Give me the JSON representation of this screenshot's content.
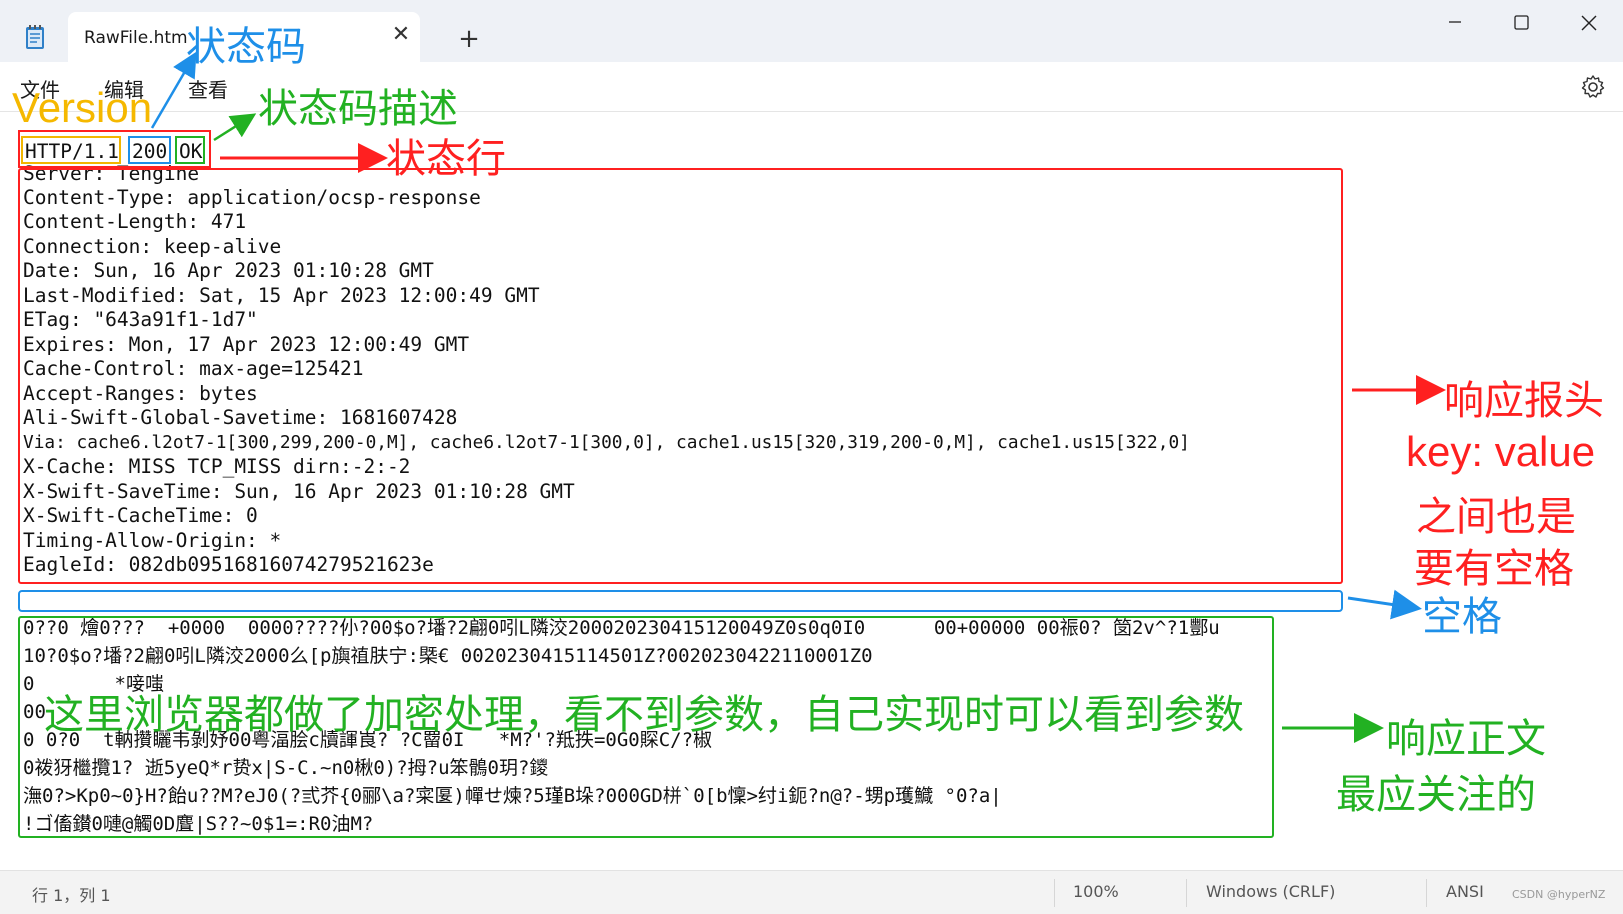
{
  "window": {
    "tab_title": "RawFile.htm",
    "tab_close": "✕",
    "new_tab": "+",
    "minimize": "—",
    "maximize": "☐",
    "close": "✕"
  },
  "menu": {
    "file": "文件",
    "edit": "编辑",
    "view": "查看"
  },
  "status_line": {
    "version": "HTTP/1.1",
    "code": "200",
    "reason": "OK"
  },
  "headers": [
    "Server: Tengine",
    "Content-Type: application/ocsp-response",
    "Content-Length: 471",
    "Connection: keep-alive",
    "Date: Sun, 16 Apr 2023 01:10:28 GMT",
    "Last-Modified: Sat, 15 Apr 2023 12:00:49 GMT",
    "ETag: \"643a91f1-1d7\"",
    "Expires: Mon, 17 Apr 2023 12:00:49 GMT",
    "Cache-Control: max-age=125421",
    "Accept-Ranges: bytes",
    "Ali-Swift-Global-Savetime: 1681607428",
    "Via: cache6.l2ot7-1[300,299,200-0,M], cache6.l2ot7-1[300,0], cache1.us15[320,319,200-0,M], cache1.us15[322,0]",
    "X-Cache: MISS TCP_MISS dirn:-2:-2",
    "X-Swift-SaveTime: Sun, 16 Apr 2023 01:10:28 GMT",
    "X-Swift-CacheTime: 0",
    "Timing-Allow-Origin: *",
    "EagleId: 082db09516816074279521623e"
  ],
  "body_lines": [
    "0??0 燴0???  +0000  0000????仦?00$o?墦?2翩0吲L隣洨200020230415120049Z0s0q0I0      00+00000 00祳0? 笝2v^?1酆u",
    "10?0$o?墦?2翩0吲L隣洨2000么[p旟禃肤宁:槩€ 0020230415114501Z?0020230422110001Z0",
    "0       *唼嗤",
    "00",
    "0 0?0  t軜攢矖韦剝妤00粤湢脍c牘諢崀? ?C罶0I   *M?'?羝抶=0G0賝C/?椒",
    "0袯犽檵攬1? 逝5yeQ*r贽x|S-C.~n0楸0)?拇?u笨鶻0玥?鑁",
    "潕0?>Kp0~0}H?飴u??M?eJ0(?弎芥{0郦\\a?寀匽)幝せ煉?5瑾B垛?000GD栟`0[b懍>纣i鈪?n@?-甥p瓁鱵 °0?a|",
    "!ゴ傗鑚0嗹@觸0D麆|S??~0$1=:R0油M?"
  ],
  "annotations": {
    "status_code": "状态码",
    "version": "Version",
    "reason_phrase": "状态码描述",
    "status_line": "状态行",
    "response_headers": "响应报头",
    "key_value": "key: value",
    "space_note_1": "之间也是",
    "space_note_2": "要有空格",
    "blank_line": "空格",
    "encrypted": "这里浏览器都做了加密处理，看不到参数，自己实现时可以看到参数",
    "response_body": "响应正文",
    "most_important": "最应关注的"
  },
  "statusbar": {
    "position": "行 1，列 1",
    "zoom": "100%",
    "line_ending": "Windows (CRLF)",
    "encoding": "ANSI",
    "credit": "CSDN @hyperNZ"
  },
  "icons": {
    "app": "notepad-icon",
    "settings": "gear-icon"
  },
  "colors": {
    "red": "#ff2020",
    "blue": "#1e8fe8",
    "green": "#22b122",
    "yellow": "#f5b800"
  }
}
